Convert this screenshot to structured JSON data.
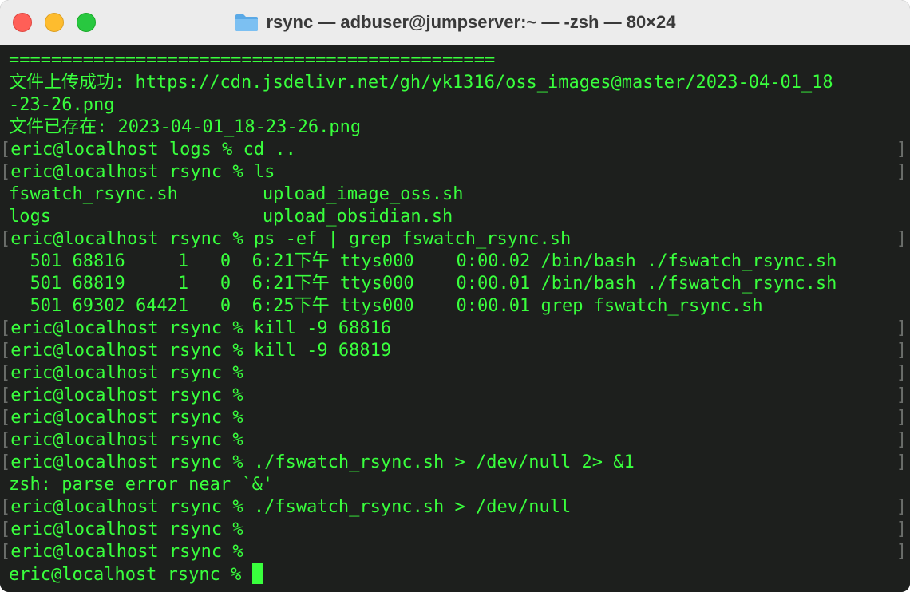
{
  "window": {
    "title": "rsync — adbuser@jumpserver:~ — -zsh — 80×24",
    "folder_icon": "folder-icon",
    "colors": {
      "text": "#39ff3d",
      "background": "#1d1f1d",
      "bracket": "#6a6d6a"
    }
  },
  "terminal": {
    "lines": [
      {
        "type": "output",
        "text": "=============================================="
      },
      {
        "type": "output",
        "text": "文件上传成功: https://cdn.jsdelivr.net/gh/yk1316/oss_images@master/2023-04-01_18"
      },
      {
        "type": "output",
        "text": "-23-26.png"
      },
      {
        "type": "output",
        "text": "文件已存在: 2023-04-01_18-23-26.png"
      },
      {
        "type": "prompt",
        "text": "eric@localhost logs % cd .."
      },
      {
        "type": "prompt",
        "text": "eric@localhost rsync % ls"
      },
      {
        "type": "output",
        "text": "fswatch_rsync.sh        upload_image_oss.sh"
      },
      {
        "type": "output",
        "text": "logs                    upload_obsidian.sh"
      },
      {
        "type": "prompt",
        "text": "eric@localhost rsync % ps -ef | grep fswatch_rsync.sh"
      },
      {
        "type": "output",
        "text": "  501 68816     1   0  6:21下午 ttys000    0:00.02 /bin/bash ./fswatch_rsync.sh"
      },
      {
        "type": "output",
        "text": "  501 68819     1   0  6:21下午 ttys000    0:00.01 /bin/bash ./fswatch_rsync.sh"
      },
      {
        "type": "output",
        "text": "  501 69302 64421   0  6:25下午 ttys000    0:00.01 grep fswatch_rsync.sh"
      },
      {
        "type": "prompt",
        "text": "eric@localhost rsync % kill -9 68816"
      },
      {
        "type": "prompt",
        "text": "eric@localhost rsync % kill -9 68819"
      },
      {
        "type": "prompt",
        "text": "eric@localhost rsync %"
      },
      {
        "type": "prompt",
        "text": "eric@localhost rsync %"
      },
      {
        "type": "prompt",
        "text": "eric@localhost rsync %"
      },
      {
        "type": "prompt",
        "text": "eric@localhost rsync %"
      },
      {
        "type": "prompt",
        "text": "eric@localhost rsync % ./fswatch_rsync.sh > /dev/null 2> &1"
      },
      {
        "type": "output",
        "text": "zsh: parse error near `&'"
      },
      {
        "type": "prompt",
        "text": "eric@localhost rsync % ./fswatch_rsync.sh > /dev/null"
      },
      {
        "type": "prompt",
        "text": "eric@localhost rsync %"
      },
      {
        "type": "prompt",
        "text": "eric@localhost rsync %"
      },
      {
        "type": "current",
        "text": "eric@localhost rsync % "
      }
    ]
  }
}
